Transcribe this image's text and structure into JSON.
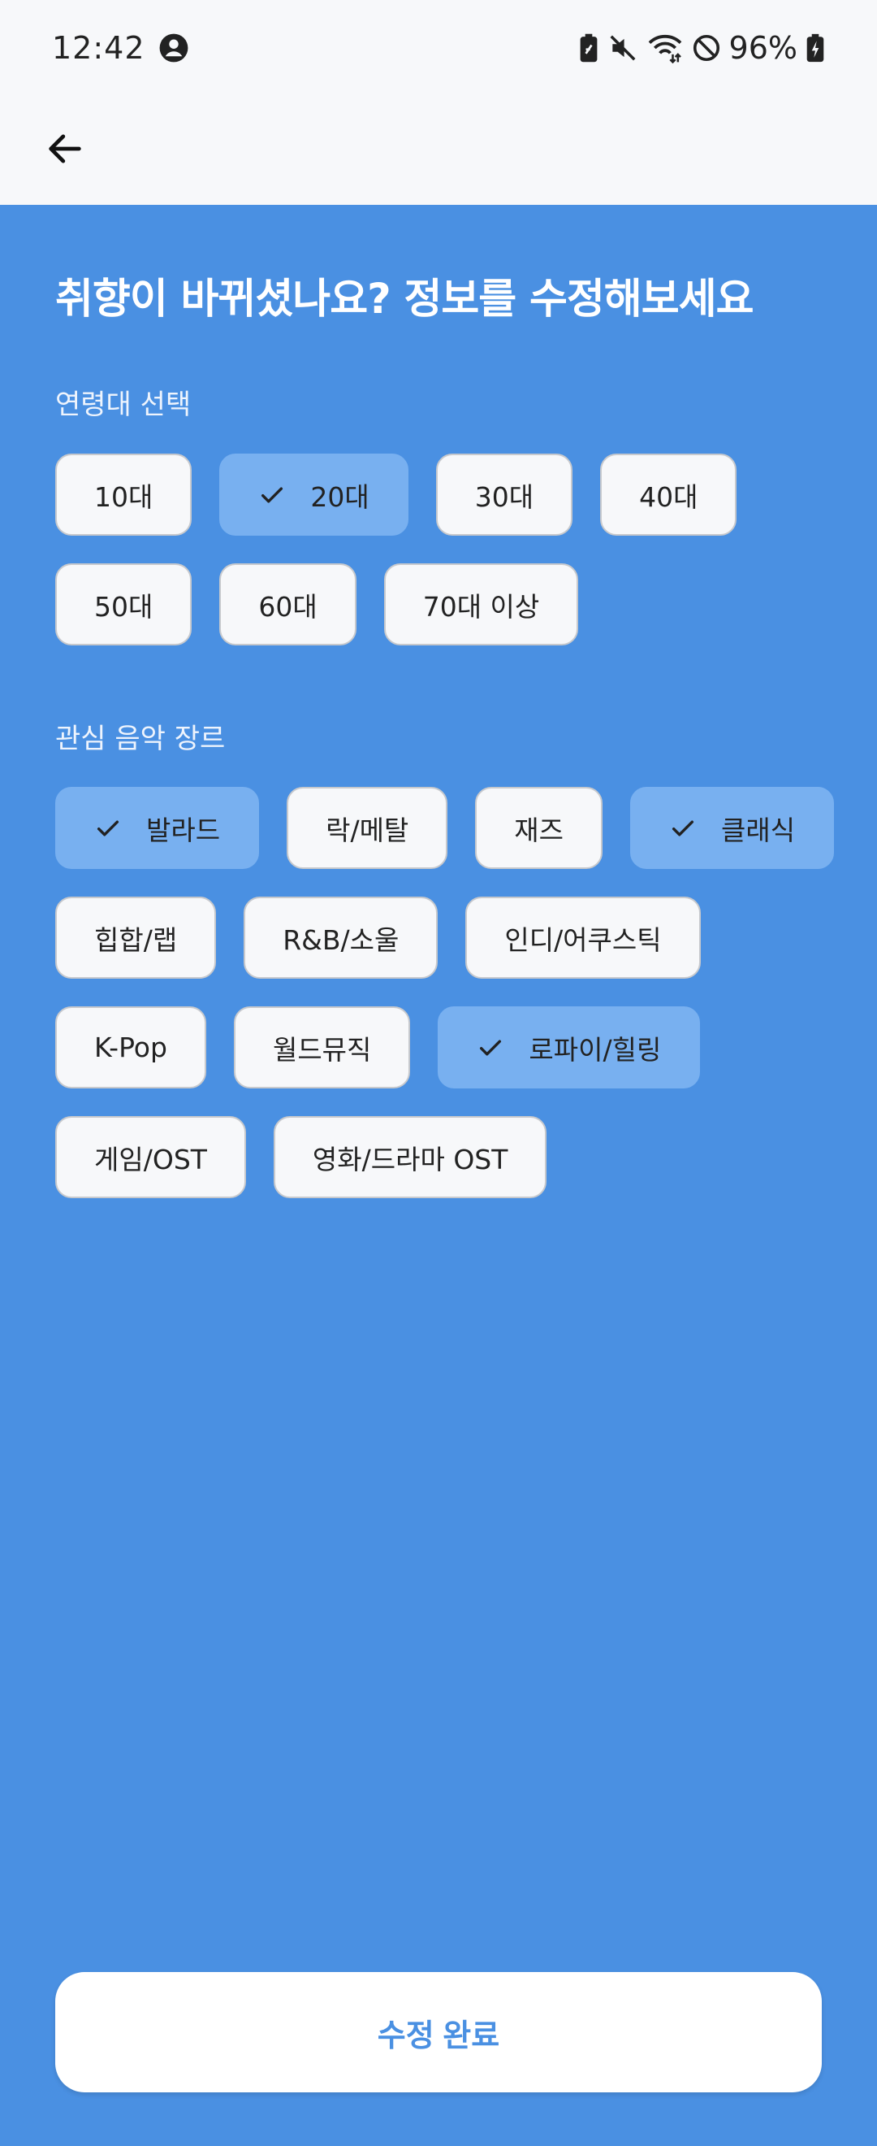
{
  "status_bar": {
    "time": "12:42",
    "battery": "96%",
    "icons": [
      "account-circle-icon",
      "battery-saver-icon",
      "muted-icon",
      "wifi-icon",
      "do-not-disturb-icon",
      "battery-charging-icon"
    ]
  },
  "app_bar": {
    "back_icon": "arrow-back-icon"
  },
  "title": "취향이 바뀌셨나요? 정보를 수정해보세요",
  "age_section": {
    "label": "연령대 선택",
    "rows": [
      [
        {
          "label": "10대",
          "selected": false
        },
        {
          "label": "20대",
          "selected": true
        },
        {
          "label": "30대",
          "selected": false
        },
        {
          "label": "40대",
          "selected": false
        }
      ],
      [
        {
          "label": "50대",
          "selected": false
        },
        {
          "label": "60대",
          "selected": false
        },
        {
          "label": "70대 이상",
          "selected": false
        }
      ]
    ]
  },
  "genre_section": {
    "label": "관심 음악 장르",
    "rows": [
      [
        {
          "label": "발라드",
          "selected": true
        },
        {
          "label": "락/메탈",
          "selected": false
        },
        {
          "label": "재즈",
          "selected": false
        },
        {
          "label": "클래식",
          "selected": true
        }
      ],
      [
        {
          "label": "힙합/랩",
          "selected": false
        },
        {
          "label": "R&B/소울",
          "selected": false
        },
        {
          "label": "인디/어쿠스틱",
          "selected": false
        }
      ],
      [
        {
          "label": "K-Pop",
          "selected": false
        },
        {
          "label": "월드뮤직",
          "selected": false
        },
        {
          "label": "로파이/힐링",
          "selected": true
        }
      ],
      [
        {
          "label": "게임/OST",
          "selected": false
        },
        {
          "label": "영화/드라마 OST",
          "selected": false
        }
      ]
    ]
  },
  "submit_label": "수정 완료",
  "colors": {
    "background": "#4a90e2",
    "chip_selected": "#78b0f0",
    "chip_default": "#f7f8fa",
    "header": "#f7f8fa"
  }
}
